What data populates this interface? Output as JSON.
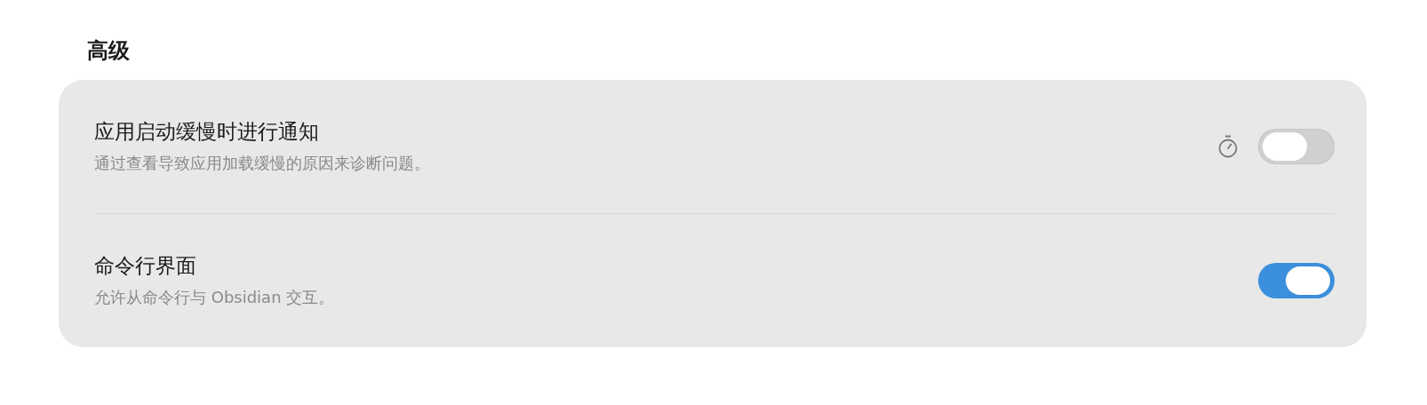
{
  "section": {
    "title": "高级"
  },
  "settings": [
    {
      "kind": "timed-toggle",
      "title": "应用启动缓慢时进行通知",
      "description": "通过查看导致应用加载缓慢的原因来诊断问题。",
      "on": false
    },
    {
      "kind": "toggle",
      "title": "命令行界面",
      "description": "允许从命令行与 Obsidian 交互。",
      "on": true
    }
  ]
}
